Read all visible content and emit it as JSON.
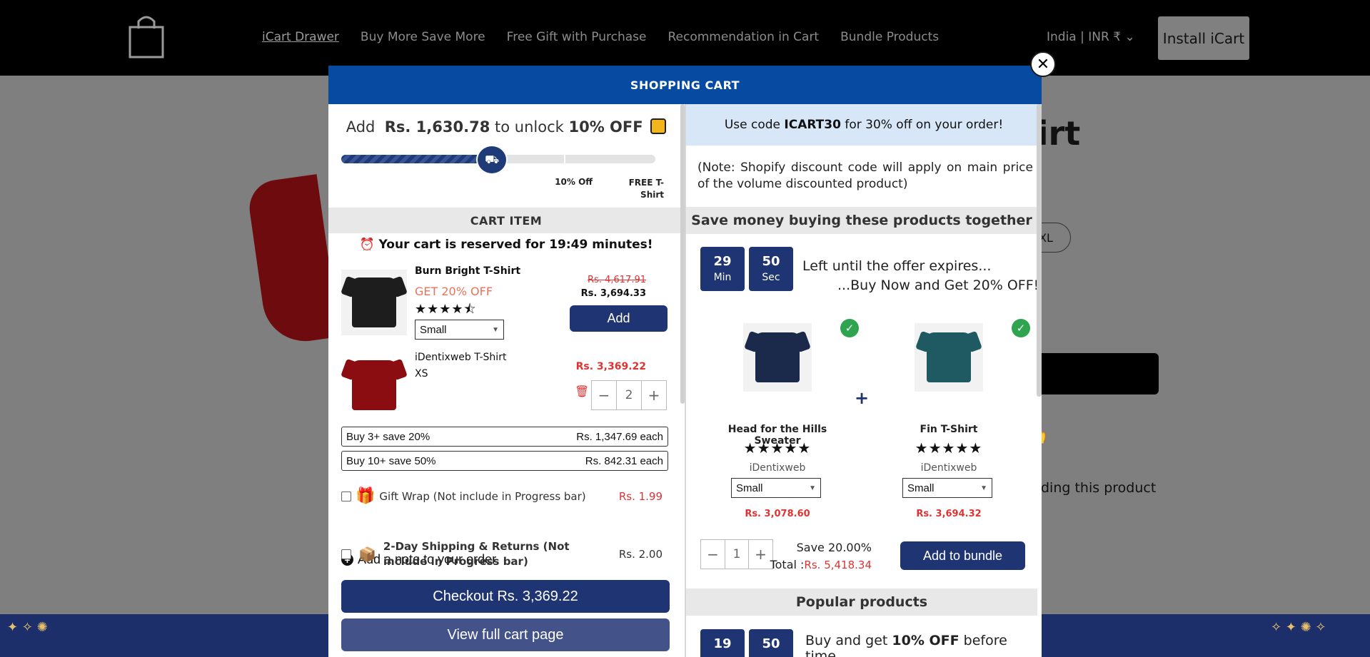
{
  "nav": {
    "links": [
      "iCart Drawer",
      "Buy More Save More",
      "Free Gift with Purchase",
      "Recommendation in Cart",
      "Bundle Products"
    ],
    "region": "India | INR ₹",
    "install_label": "Install iCart"
  },
  "page": {
    "title_fragment": "hirt",
    "size_fragment": "XL",
    "text_fragment": "ding this product"
  },
  "cart": {
    "header": "SHOPPING CART",
    "unlock": {
      "prefix": "Add",
      "amount": "Rs. 1,630.78",
      "middle": "to unlock",
      "reward": "10% OFF",
      "progress_fraction": 0.48
    },
    "milestones": [
      "10% Off",
      "FREE T-Shirt"
    ],
    "cart_item_heading": "CART ITEM",
    "reserved": "Your cart is reserved for 19:49 minutes!",
    "upsell": {
      "name": "Burn Bright T-Shirt",
      "discount": "GET 20% OFF",
      "rating": 4.5,
      "stars": "★★★★⯪",
      "size": "Small",
      "old_price": "Rs. 4,617.91",
      "new_price": "Rs. 3,694.33",
      "add_label": "Add"
    },
    "line_item": {
      "name": "iDentixweb T-Shirt",
      "variant": "XS",
      "price": "Rs. 3,369.22",
      "quantity": "2"
    },
    "tiers": [
      {
        "label": "Buy 3+ save 20%",
        "price": "Rs. 1,347.69 each"
      },
      {
        "label": "Buy 10+ save 50%",
        "price": "Rs. 842.31 each"
      }
    ],
    "gift_wrap": {
      "label": "Gift Wrap (Not include in Progress bar)",
      "price": "Rs. 1.99"
    },
    "note_label": "Add a note to your order",
    "shipping": {
      "label": "2-Day Shipping & Returns (Not include in Progress bar)",
      "price": "Rs. 2.00"
    },
    "checkout_label": "Checkout Rs. 3,369.22",
    "view_cart_label": "View full cart page"
  },
  "right": {
    "coupon": {
      "prefix": "Use code",
      "code": "ICART30",
      "suffix": "for 30% off on your order!"
    },
    "disclaimer": "(Note: Shopify discount code will apply on main price of the volume discounted product)",
    "together_heading": "Save money buying these products together",
    "timer": {
      "min": "29",
      "min_label": "Min",
      "sec": "50",
      "sec_label": "Sec"
    },
    "offer_line1": "Left until the offer expires...",
    "offer_line2": "...Buy Now and Get 20% OFF!",
    "products": [
      {
        "name": "Head for the Hills Sweater",
        "stars": "★★★★★",
        "vendor": "iDentixweb",
        "size": "Small",
        "price": "Rs. 3,078.60"
      },
      {
        "name": "Fin T-Shirt",
        "stars": "★★★★★",
        "vendor": "iDentixweb",
        "size": "Small",
        "price": "Rs. 3,694.32"
      }
    ],
    "bundle_qty": "1",
    "save_label": "Save 20.00%",
    "total_label": "Total :",
    "total_value": "Rs. 5,418.34",
    "add_bundle_label": "Add to bundle",
    "popular_heading": "Popular products",
    "popular_timer": {
      "a": "19",
      "b": "50"
    },
    "popular_text_prefix": "Buy and get",
    "popular_text_bold": "10% OFF",
    "popular_text_suffix": "before time"
  },
  "colors": {
    "navy": "#1f3472",
    "header_blue": "#064aa1",
    "red": "#d33333",
    "coupon_bg": "#d8e7f8"
  }
}
